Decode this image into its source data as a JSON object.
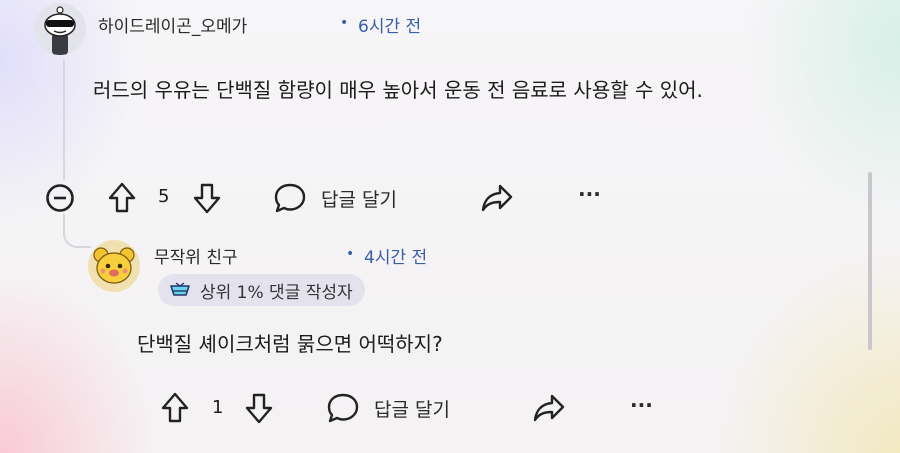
{
  "comments": [
    {
      "username": "하이드레이곤_오메가",
      "separator": "•",
      "time": "6시간 전",
      "body": "러드의 우유는 단백질 함량이 매우 높아서 운동 전 음료로 사용할 수 있어.",
      "votes": "5",
      "reply_label": "답글 달기",
      "more_label": "···"
    },
    {
      "username": "무작위 친구",
      "separator": "•",
      "time": "4시간 전",
      "badge": "상위 1% 댓글 작성자",
      "body": "단백질 셰이크처럼 묽으면 어떡하지?",
      "votes": "1",
      "reply_label": "답글 달기",
      "more_label": "···"
    }
  ],
  "icons": {
    "collapse": "collapse-minus-icon",
    "upvote": "upvote-arrow-icon",
    "downvote": "downvote-arrow-icon",
    "reply": "speech-bubble-icon",
    "share": "share-arrow-icon",
    "badge": "trophy-badge-icon"
  }
}
